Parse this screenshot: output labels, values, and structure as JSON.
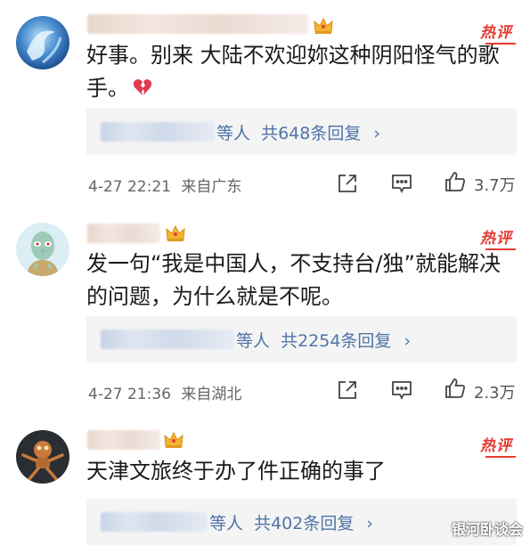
{
  "hot_label": "热评",
  "comments": [
    {
      "text": "好事。别来 大陆不欢迎妳这种阴阳怪气的歌手。",
      "reply_suffix": "等人",
      "reply_count": "共648条回复",
      "chevron": "›",
      "date": "4-27 22:21",
      "location": "来自广东",
      "likes": "3.7万"
    },
    {
      "text": "发一句“我是中国人，不支持台/独”就能解决的问题，为什么就是不呢。",
      "reply_suffix": "等人",
      "reply_count": "共2254条回复",
      "chevron": "›",
      "date": "4-27 21:36",
      "location": "来自湖北",
      "likes": "2.3万"
    },
    {
      "text": "天津文旅终于办了件正确的事了",
      "reply_suffix": "等人",
      "reply_count": "共402条回复",
      "chevron": "›"
    }
  ],
  "watermark": "银河卧谈会",
  "colors": {
    "hot": "#e63a2e",
    "link": "#4f74a8",
    "reply_bg": "#f4f4f4"
  },
  "icons": [
    "crown-icon",
    "broken-heart-icon",
    "share-icon",
    "comment-icon",
    "like-icon"
  ]
}
